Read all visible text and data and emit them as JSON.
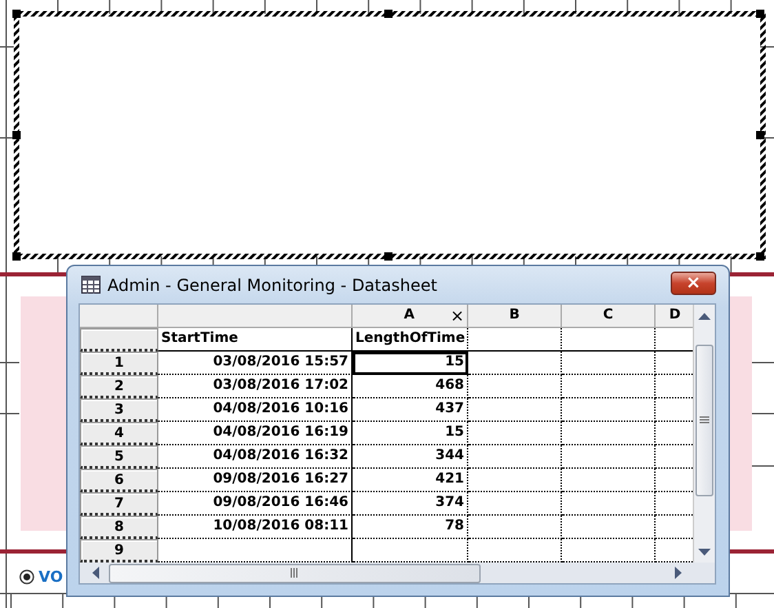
{
  "radio": {
    "label": "VO",
    "selected": true
  },
  "datasheet": {
    "title": "Admin - General Monitoring - Datasheet",
    "close_mark": "×",
    "columns": [
      {
        "field": "StartTime"
      },
      {
        "letter": "A",
        "field": "LengthOfTime",
        "close_mark": "×"
      },
      {
        "letter": "B"
      },
      {
        "letter": "C"
      },
      {
        "letter": "D"
      }
    ],
    "rows": [
      {
        "number": "1",
        "cells": [
          "03/08/2016 15:57",
          "15"
        ],
        "selected": true
      },
      {
        "number": "2",
        "cells": [
          "03/08/2016 17:02",
          "468"
        ],
        "selected": false
      },
      {
        "number": "3",
        "cells": [
          "04/08/2016 10:16",
          "437"
        ],
        "selected": false
      },
      {
        "number": "4",
        "cells": [
          "04/08/2016 16:19",
          "15"
        ],
        "selected": false
      },
      {
        "number": "5",
        "cells": [
          "04/08/2016 16:32",
          "344"
        ],
        "selected": false
      },
      {
        "number": "6",
        "cells": [
          "09/08/2016 16:27",
          "421"
        ],
        "selected": false
      },
      {
        "number": "7",
        "cells": [
          "09/08/2016 16:46",
          "374"
        ],
        "selected": false
      },
      {
        "number": "8",
        "cells": [
          "10/08/2016 08:11",
          "78"
        ],
        "selected": false
      },
      {
        "number": "9",
        "selected": false
      }
    ]
  }
}
